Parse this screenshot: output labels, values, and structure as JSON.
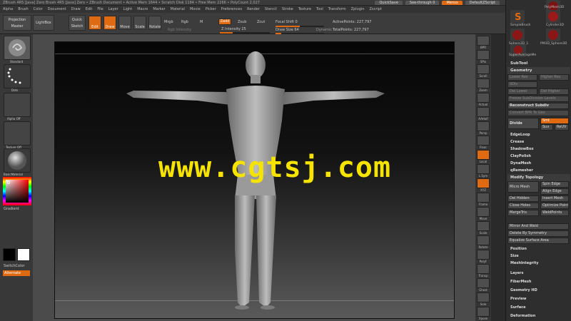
{
  "titlebar": {
    "text": "ZBrush 4R5 [Java] Zero Brush 4R5 [Java] Zero  • ZBrush Document  • Active Mem 1644 • Scratch Disk 1184 • Free Mem 2266 • PolyCount 2,027",
    "quicksave": "QuickSave",
    "seethrough": "See-through  0",
    "menus": "Menus",
    "script": "DefaultZScript"
  },
  "menubar": {
    "items": [
      "Alpha",
      "Brush",
      "Color",
      "Document",
      "Draw",
      "Edit",
      "File",
      "Layer",
      "Light",
      "Macro",
      "Marker",
      "Material",
      "Movie",
      "Picker",
      "Preferences",
      "Render",
      "Stencil",
      "Stroke",
      "Texture",
      "Tool",
      "Transform",
      "Zplugin",
      "Zscript"
    ]
  },
  "toolbar": {
    "projection_master": "Projection Master",
    "lightbox": "LightBox",
    "quick_sketch": "Quick Sketch",
    "edit": "Edit",
    "draw": "Draw",
    "move": "Move",
    "scale": "Scale",
    "rotate": "Rotate",
    "mrgb": "Mrgb",
    "rgb": "Rgb",
    "m": "M",
    "zadd": "Zadd",
    "zsub": "Zsub",
    "zcut": "Zcut",
    "focal_shift": "Focal Shift 0",
    "rgb_intensity": "Rgb Intensity",
    "z_intensity": "Z Intensity 25",
    "draw_size": "Draw Size 64",
    "dynamic": "Dynamic",
    "active_points": "ActivePoints: 227,797",
    "total_points": "TotalPoints: 227,797"
  },
  "left_shelf": {
    "standard": "Standard",
    "dots": "Dots",
    "alpha_off": "Alpha Off",
    "texture_off": "Texture Off",
    "basic_material": "BasicMaterial",
    "gradient": "Gradient",
    "switch_color": "SwitchColor",
    "alternate": "Alternate"
  },
  "right_shelf": {
    "items": [
      "BPR",
      "SPix",
      "Scroll",
      "Zoom",
      "Actual",
      "AAHalf",
      "Persp",
      "Floor",
      "Local",
      "L.Sym",
      "XYZ",
      "Frame",
      "Move",
      "Scale",
      "Rotate",
      "PolyF",
      "Transp",
      "Ghost",
      "Solo",
      "Xpose"
    ]
  },
  "panel": {
    "tools": [
      "SimpleBrush",
      "PolyMesh3D",
      "Cylinder3D",
      "Sphere3D_1",
      "PM3D_Sphere3D",
      "SuperAverageMe"
    ],
    "sections": {
      "subtool": "SubTool",
      "geometry": "Geometry",
      "reconstruct": "Reconstruct Subdiv",
      "convert": "Convert BPR To Geo",
      "divide": "Divide",
      "smt": "Smt",
      "suv": "Suv",
      "rsuv": "ReUV",
      "edgeloop": "EdgeLoop",
      "crease": "Crease",
      "shadowbox": "ShadowBox",
      "claypolish": "ClayPolish",
      "dynamesh": "DynaMesh",
      "qremesher": "qRemesher",
      "modify_topology": "Modify Topology",
      "micro_mesh": "Micro Mesh",
      "spin_edge": "Spin Edge",
      "align_edge": "Align Edge",
      "del_hidden": "Del Hidden",
      "insert_mesh": "Insert Mesh",
      "close_holes": "Close Holes",
      "optimize_points": "Optimize Points",
      "merge_tris": "MergeTris",
      "weld_points": "WeldPoints",
      "mirror_and_weld": "Mirror And Weld",
      "delete_by_symmetry": "Delete By Symmetry",
      "equalize": "Equalize Surface Area",
      "position": "Position",
      "size": "Size",
      "meshintegrity": "MeshIntegrity",
      "layers": "Layers",
      "fibermesh": "FiberMesh",
      "geometry_hd": "Geometry HD",
      "preview": "Preview",
      "surface": "Surface",
      "deformation": "Deformation",
      "lower_res": "Lower Res",
      "higher_res": "Higher Res",
      "del_lower": "Del Lower",
      "del_higher": "Del Higher",
      "sdiv": "SDiv",
      "freeze_subdivision": "Freeze SubDivision Levels"
    }
  },
  "watermark": "www.cgtsj.com",
  "colors": {
    "accent": "#e06a12",
    "watermark": "#f6e400"
  }
}
